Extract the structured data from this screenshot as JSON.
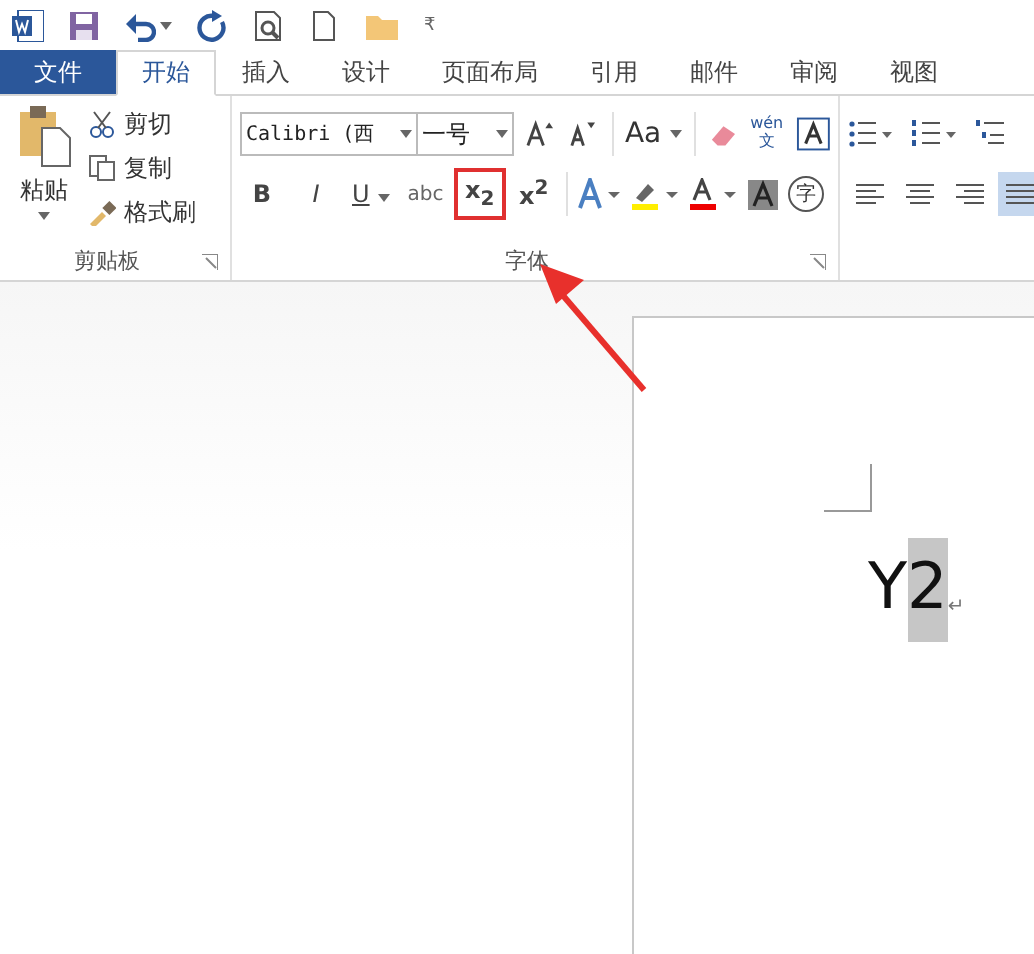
{
  "quick_access": {
    "customize": "₹"
  },
  "tabs": [
    {
      "label": "文件",
      "kind": "file",
      "selected": false
    },
    {
      "label": "开始",
      "kind": "tab",
      "selected": true
    },
    {
      "label": "插入",
      "kind": "tab",
      "selected": false
    },
    {
      "label": "设计",
      "kind": "tab",
      "selected": false
    },
    {
      "label": "页面布局",
      "kind": "tab",
      "selected": false
    },
    {
      "label": "引用",
      "kind": "tab",
      "selected": false
    },
    {
      "label": "邮件",
      "kind": "tab",
      "selected": false
    },
    {
      "label": "审阅",
      "kind": "tab",
      "selected": false
    },
    {
      "label": "视图",
      "kind": "tab",
      "selected": false
    }
  ],
  "clipboard": {
    "paste": "粘贴",
    "items": [
      "剪切",
      "复制",
      "格式刷"
    ],
    "label": "剪贴板"
  },
  "font": {
    "name": "Calibri (西",
    "size": "一号",
    "case": "Aa",
    "phonetic": [
      "wén",
      "文"
    ],
    "row2": [
      {
        "glyph": "B",
        "kind": "bold",
        "highlighted": false
      },
      {
        "glyph": "I",
        "kind": "italic",
        "highlighted": false
      },
      {
        "glyph": "U",
        "kind": "underline",
        "highlighted": false
      },
      {
        "glyph": "abc",
        "kind": "strike",
        "highlighted": false
      },
      {
        "glyph": "x$_{2}$",
        "kind": "sub",
        "highlighted": true
      },
      {
        "glyph": "x$^{2}$",
        "kind": "sup",
        "highlighted": false
      }
    ],
    "enclosed": "字",
    "label": "字体"
  },
  "paragraph": {
    "align": [
      {
        "kind": "left",
        "selected": false
      },
      {
        "kind": "center",
        "selected": false
      },
      {
        "kind": "right",
        "selected": false
      },
      {
        "kind": "justify",
        "selected": true
      }
    ]
  },
  "document": {
    "runs": [
      {
        "text": "Y",
        "selected": false
      },
      {
        "text": "2",
        "selected": true
      }
    ],
    "mark": "↵"
  }
}
